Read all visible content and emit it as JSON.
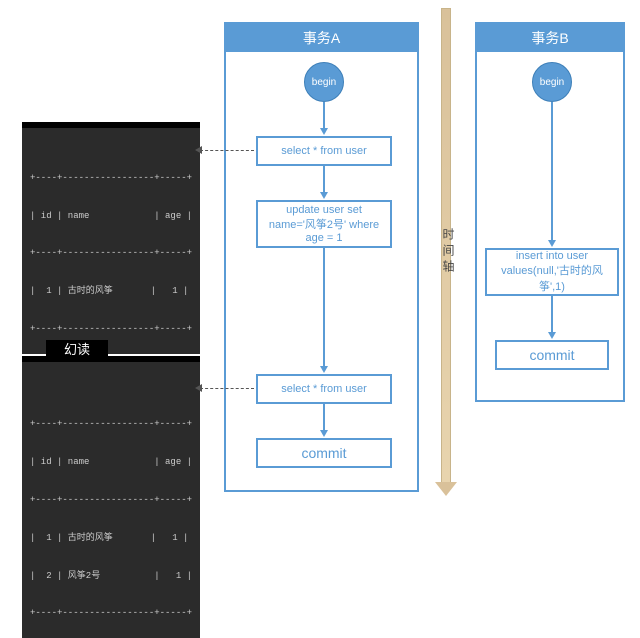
{
  "transactions": {
    "a": {
      "title": "事务A",
      "begin": "begin",
      "step1": "select * from user",
      "step2": "update user set name='风筝2号' where age = 1",
      "step3": "select * from user",
      "commit": "commit"
    },
    "b": {
      "title": "事务B",
      "begin": "begin",
      "step1": "insert into user values(null,'古时的风筝',1)",
      "commit": "commit"
    }
  },
  "timeline_label": "时间轴",
  "phantom_label": "幻读",
  "result1": {
    "header": "| id | name            | age |",
    "divider": "+----+-----------------+-----+",
    "rows": [
      "|  1 | 古时的风筝       |   1 |"
    ]
  },
  "result2": {
    "header": "| id | name            | age |",
    "divider": "+----+-----------------+-----+",
    "rows": [
      "|  1 | 古时的风筝       |   1 |",
      "|  2 | 风筝2号          |   1 |"
    ]
  },
  "chart_data": {
    "type": "table",
    "title": "Phantom Read (幻读) illustration with two transactions",
    "series": [
      {
        "name": "事务A",
        "steps": [
          "begin",
          "select * from user",
          "update user set name='风筝2号' where age = 1",
          "select * from user",
          "commit"
        ]
      },
      {
        "name": "事务B",
        "steps": [
          "begin",
          "insert into user values(null,'古时的风筝',1)",
          "commit"
        ]
      }
    ],
    "results": [
      {
        "after_step": "事务A select #1",
        "rows": [
          {
            "id": 1,
            "name": "古时的风筝",
            "age": 1
          }
        ]
      },
      {
        "after_step": "事务A select #2",
        "label": "幻读",
        "rows": [
          {
            "id": 1,
            "name": "古时的风筝",
            "age": 1
          },
          {
            "id": 2,
            "name": "风筝2号",
            "age": 1
          }
        ]
      }
    ]
  }
}
